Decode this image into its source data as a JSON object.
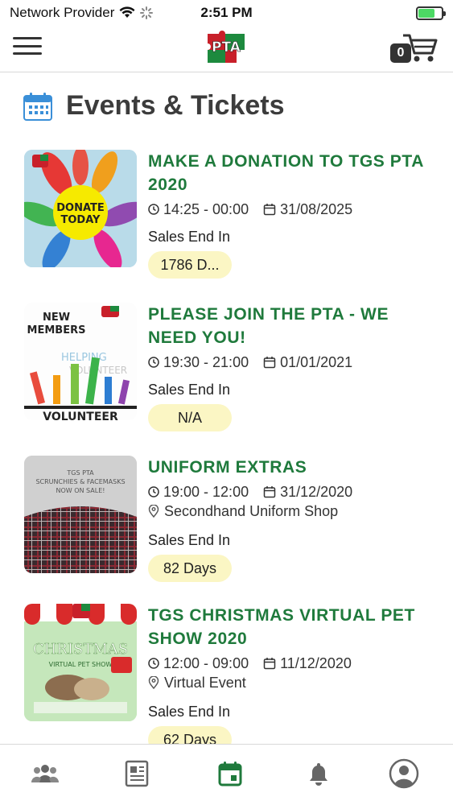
{
  "status_bar": {
    "carrier": "Network Provider",
    "time": "2:51 PM"
  },
  "header": {
    "logo_text": "PTA",
    "cart_count": "0"
  },
  "page": {
    "title": "Events & Tickets"
  },
  "events": [
    {
      "title": "MAKE A DONATION TO TGS PTA 2020",
      "time": "14:25 - 00:00",
      "date": "31/08/2025",
      "sales_label": "Sales End In",
      "sales_value": "1786 D...",
      "thumb_text": "DONATE TODAY"
    },
    {
      "title": "PLEASE JOIN THE PTA - WE NEED YOU!",
      "time": "19:30 - 21:00",
      "date": "01/01/2021",
      "sales_label": "Sales End In",
      "sales_value": "N/A",
      "thumb_text": "NEW MEMBERS"
    },
    {
      "title": "UNIFORM EXTRAS",
      "time": "19:00 - 12:00",
      "date": "31/12/2020",
      "location": "Secondhand Uniform Shop",
      "sales_label": "Sales End In",
      "sales_value": "82 Days",
      "thumb_text": "TGS PTA SCRUNCHIES & FACEMASKS NOW ON SALE!"
    },
    {
      "title": "TGS CHRISTMAS VIRTUAL PET SHOW 2020",
      "time": "12:00 - 09:00",
      "date": "11/12/2020",
      "location": "Virtual Event",
      "sales_label": "Sales End In",
      "sales_value": "62 Days",
      "thumb_text": "CHRISTMAS"
    }
  ],
  "tabs": [
    {
      "icon": "group-icon"
    },
    {
      "icon": "newsletter-icon"
    },
    {
      "icon": "calendar-icon",
      "active": true
    },
    {
      "icon": "bell-icon"
    },
    {
      "icon": "profile-icon"
    }
  ],
  "colors": {
    "accent": "#1f7a3c",
    "pill": "#fbf6c4",
    "icon_blue": "#3a8fd8"
  }
}
